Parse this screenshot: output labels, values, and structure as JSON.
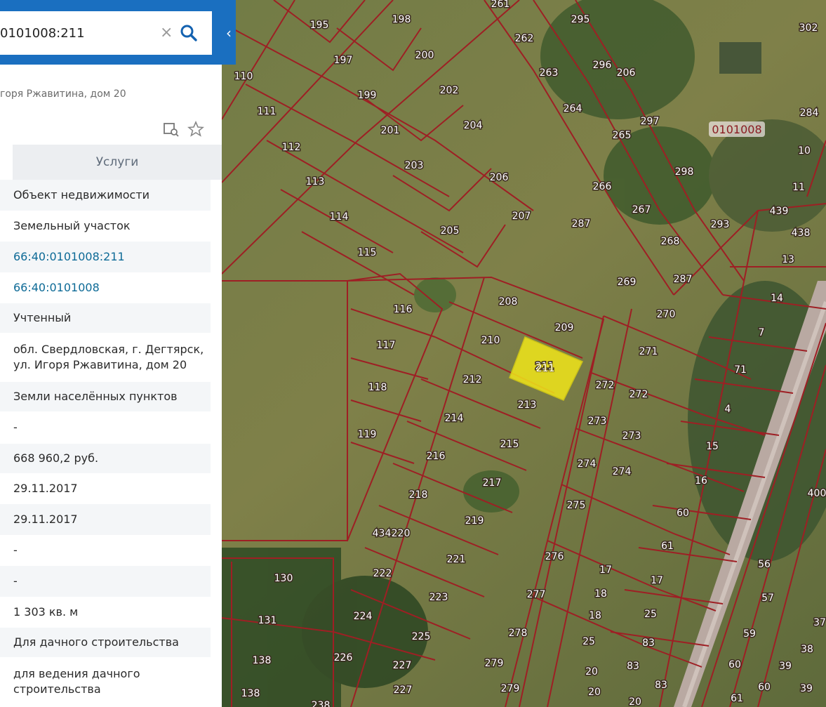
{
  "search": {
    "query": "0101008:211",
    "clear_icon": "close-icon",
    "search_icon": "search-icon",
    "collapse_icon": "chevron-left-icon"
  },
  "object": {
    "address_short": "гоpя Ржавитина, дом 20"
  },
  "tools": {
    "inspect_icon": "zoom-to-object-icon",
    "favorite_icon": "star-icon"
  },
  "tabs": {
    "services": "Услуги"
  },
  "properties": [
    {
      "value": "Объект недвижимости",
      "link": false
    },
    {
      "value": "Земельный участок",
      "link": false
    },
    {
      "value": "66:40:0101008:211",
      "link": true
    },
    {
      "value": "66:40:0101008",
      "link": true
    },
    {
      "value": "Учтенный",
      "link": false
    },
    {
      "value": "обл. Свердловская, г. Дегтярск, ул. Игоря Ржавитина, дом 20",
      "link": false
    },
    {
      "value": "Земли населённых пунктов",
      "link": false
    },
    {
      "value": "-",
      "link": false
    },
    {
      "value": "668 960,2 руб.",
      "link": false
    },
    {
      "value": "29.11.2017",
      "link": false
    },
    {
      "value": "29.11.2017",
      "link": false
    },
    {
      "value": "-",
      "link": false
    },
    {
      "value": "-",
      "link": false
    },
    {
      "value": "1 303 кв. м",
      "link": false
    },
    {
      "value": "Для дачного строительства",
      "link": false
    },
    {
      "value": "для ведения дачного строительства",
      "link": false
    }
  ],
  "map": {
    "quarter_label": "0101008",
    "selected_parcel": "211",
    "colors": {
      "boundary": "#9e1f24",
      "selected": "#f0e51a",
      "field": "#7a7d45",
      "forest": "#2f4a22"
    },
    "parcel_labels": [
      "195",
      "198",
      "261",
      "295",
      "302",
      "197",
      "200",
      "262",
      "110",
      "263",
      "296",
      "206",
      "111",
      "199",
      "202",
      "264",
      "284",
      "297",
      "0101008",
      "112",
      "201",
      "204",
      "265",
      "10",
      "203",
      "206",
      "266",
      "298",
      "113",
      "11",
      "267",
      "439",
      "114",
      "207",
      "287",
      "293",
      "205",
      "268",
      "438",
      "115",
      "13",
      "269",
      "287",
      "116",
      "208",
      "270",
      "14",
      "209",
      "117",
      "210",
      "271",
      "7",
      "211",
      "71",
      "118",
      "212",
      "272",
      "272",
      "213",
      "273",
      "4",
      "214",
      "273",
      "119",
      "15",
      "215",
      "274",
      "216",
      "274",
      "217",
      "16",
      "218",
      "275",
      "400",
      "219",
      "60",
      "434",
      "220",
      "61",
      "221",
      "276",
      "17",
      "56",
      "222",
      "130",
      "17",
      "277",
      "18",
      "57",
      "223",
      "18",
      "25",
      "59",
      "37",
      "224",
      "131",
      "25",
      "83",
      "225",
      "278",
      "38",
      "226",
      "60",
      "39",
      "138",
      "227",
      "279",
      "83",
      "20",
      "227",
      "279",
      "83",
      "61",
      "60",
      "39",
      "138",
      "20",
      "20",
      "238"
    ]
  }
}
